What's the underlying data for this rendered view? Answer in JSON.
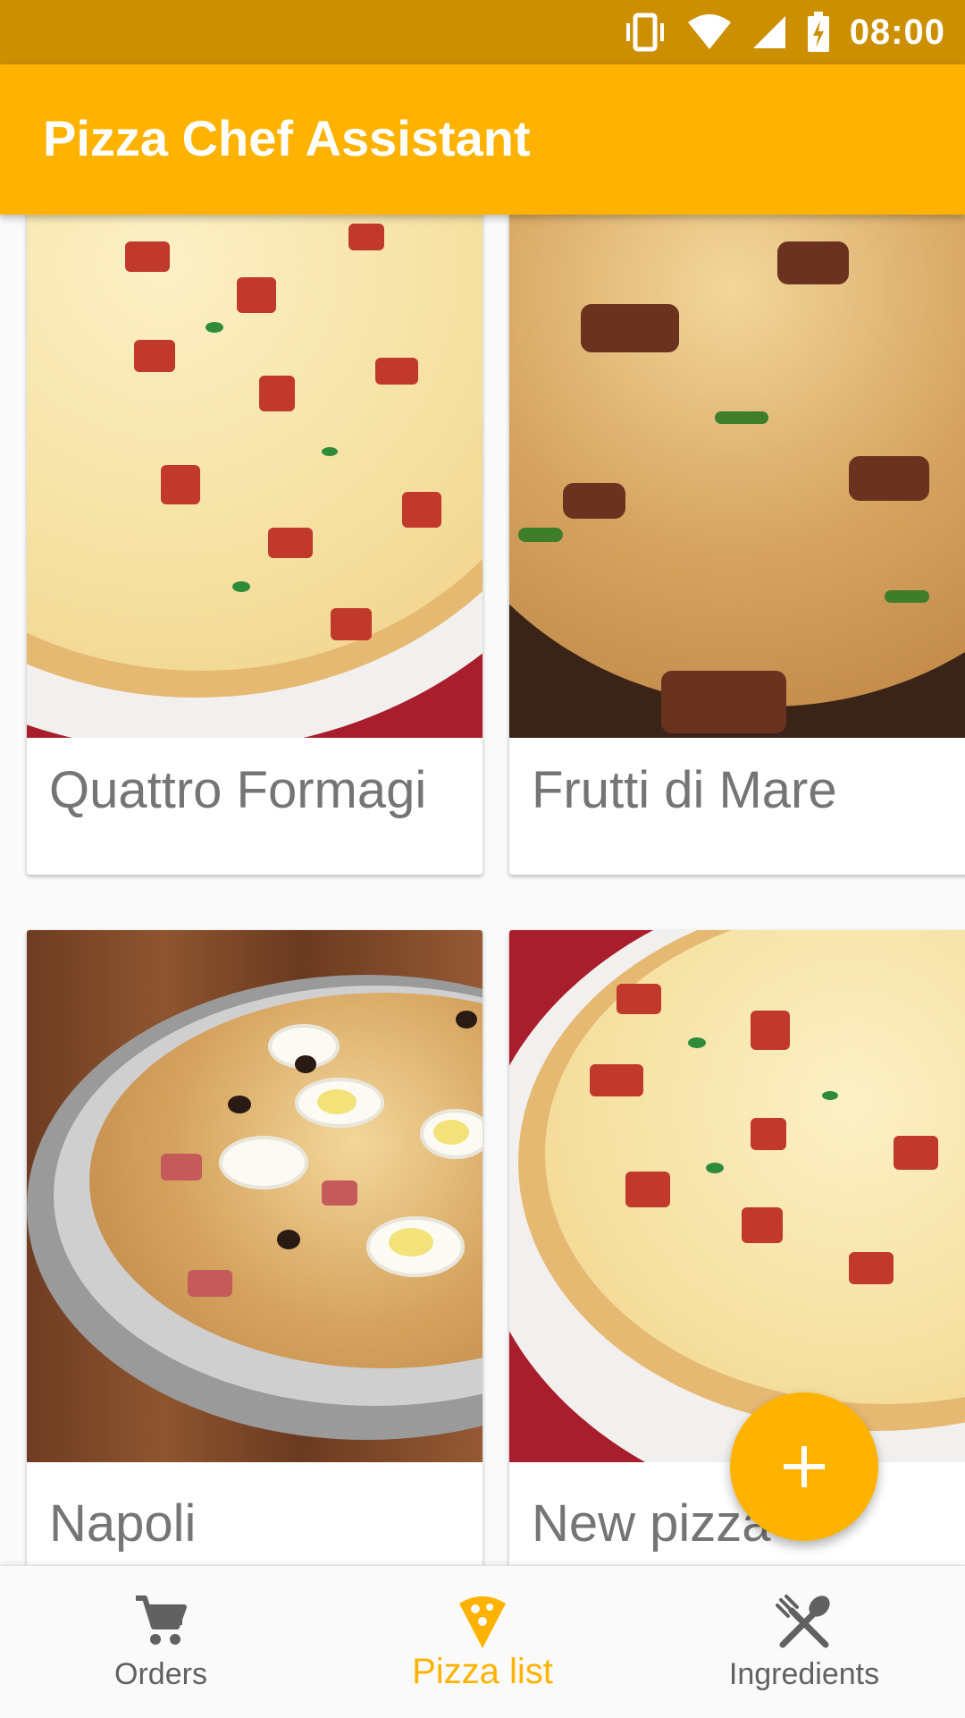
{
  "status_bar": {
    "time": "08:00",
    "icons": [
      "vibrate-icon",
      "wifi-icon",
      "cell-signal-icon",
      "battery-charging-icon"
    ]
  },
  "app_bar": {
    "title": "Pizza Chef Assistant"
  },
  "pizzas": [
    {
      "name": "Quattro Formagi"
    },
    {
      "name": "Frutti di Mare"
    },
    {
      "name": "Napoli"
    },
    {
      "name": "New pizza"
    }
  ],
  "fab": {
    "icon": "add-icon"
  },
  "bottom_nav": {
    "items": [
      {
        "label": "Orders",
        "icon": "cart-icon",
        "active": false
      },
      {
        "label": "Pizza list",
        "icon": "pizza-slice-icon",
        "active": true
      },
      {
        "label": "Ingredients",
        "icon": "cutlery-icon",
        "active": false
      }
    ]
  },
  "colors": {
    "primary": "#ffb300",
    "primary_dark": "#cc8f00",
    "label_text": "#757575",
    "nav_inactive": "#616161"
  }
}
